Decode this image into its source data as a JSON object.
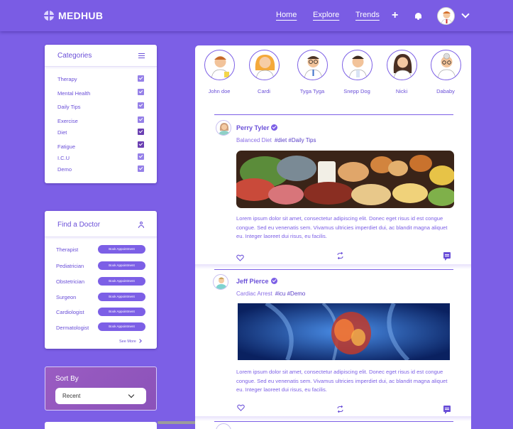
{
  "header": {
    "logo": "MEDHUB",
    "nav": [
      "Home",
      "Explore",
      "Trends"
    ]
  },
  "categories": {
    "title": "Categories",
    "items": [
      {
        "label": "Therapy",
        "checked": true
      },
      {
        "label": "Mental Health",
        "checked": true
      },
      {
        "label": "Daily Tips",
        "checked": true
      },
      {
        "label": "Exercise",
        "checked": true
      },
      {
        "label": "Diet",
        "checked": true
      },
      {
        "label": "Fatigue",
        "checked": true
      },
      {
        "label": "I.C.U",
        "checked": true
      },
      {
        "label": "Demo",
        "checked": true
      }
    ]
  },
  "find_doctor": {
    "title": "Find a Doctor",
    "button_label": "Book Appointment",
    "doctors": [
      "Therapist",
      "Pediatrician",
      "Obstetrician",
      "Surgeon",
      "Cardiologist",
      "Dermatologist"
    ],
    "see_more": "See More"
  },
  "sort": {
    "title": "Sort By",
    "selected": "Recent"
  },
  "stories": [
    "John doe",
    "Cardi",
    "Tyga Tyga",
    "Snepp Dog",
    "Nicki",
    "Dababy"
  ],
  "posts": [
    {
      "author": "Perry Tyler",
      "category": "Balanced Diet",
      "hashtags": "#diet #Daily Tips",
      "text": "Lorem ipsum dolor sit amet, consectetur adipiscing elit. Donec eget risus id est congue congue. Sed eu venenatis sem. Vivamus ultricies imperdiet dui, ac blandit magna aliquet eu. Integer laoreet dui risus, eu facilis."
    },
    {
      "author": "Jeff Pierce",
      "category": "Cardiac Arrest",
      "hashtags": "#icu #Demo",
      "text": "Lorem ipsum dolor sit amet, consectetur adipiscing elit. Donec eget risus id est congue congue. Sed eu venenatis sem. Vivamus ultricies imperdiet dui, ac blandit magna aliquet eu. Integer laoreet dui risus, eu facilis."
    }
  ],
  "colors": {
    "background": "#7c5fe6",
    "accent": "#6a4fd8",
    "sort_card": "#9a5cc2"
  }
}
